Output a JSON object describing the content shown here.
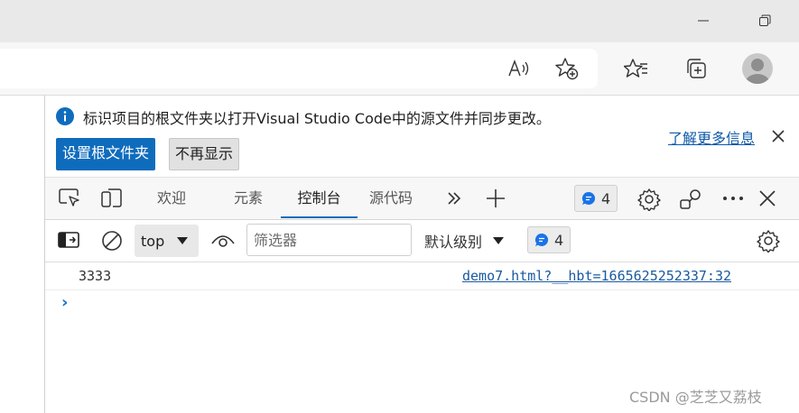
{
  "infobar": {
    "message": "标识项目的根文件夹以打开Visual Studio Code中的源文件并同步更改。",
    "set_root_label": "设置根文件夹",
    "dont_show_label": "不再显示",
    "learn_more_label": "了解更多信息"
  },
  "tabs": [
    {
      "label": "欢迎",
      "active": false
    },
    {
      "label": "元素",
      "active": false
    },
    {
      "label": "控制台",
      "active": true
    },
    {
      "label": "源代码",
      "active": false
    }
  ],
  "tabbar": {
    "issues_count": "4"
  },
  "toolbar": {
    "context_value": "top",
    "filter_placeholder": "筛选器",
    "level_label": "默认级别",
    "issues_count": "4"
  },
  "console": {
    "log_message": "3333",
    "log_source": "demo7.html?__hbt=1665625252337:32",
    "prompt_symbol": "›"
  },
  "watermark": "CSDN @芝芝又荔枝",
  "colors": {
    "accent": "#0f6cbd",
    "link": "#0f5aa8",
    "info_icon": "#0f6cbd",
    "issues_icon": "#1a73e8"
  },
  "icons": [
    "minimize-icon",
    "restore-icon",
    "read-aloud-icon",
    "add-favorite-icon",
    "favorites-icon",
    "collections-icon",
    "profile-icon",
    "info-icon",
    "close-icon",
    "inspect-icon",
    "device-emulation-icon",
    "more-tabs-icon",
    "add-tab-icon",
    "issues-icon",
    "settings-icon",
    "customize-icon",
    "more-icon",
    "sidebar-icon",
    "clear-icon",
    "eye-icon",
    "dropdown-icon"
  ]
}
